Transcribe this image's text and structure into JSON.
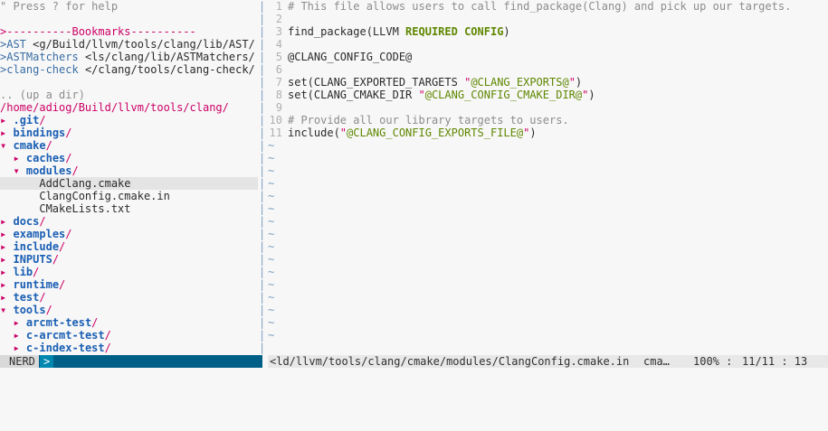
{
  "tree": {
    "help_line": "\" Press ? for help",
    "bookmarks_header": ">----------Bookmarks----------",
    "bookmarks": [
      {
        "name": "AST",
        "path": " <g/Build/llvm/tools/clang/lib/AST/"
      },
      {
        "name": "ASTMatchers",
        "path": " <ls/clang/lib/ASTMatchers/"
      },
      {
        "name": "clang-check",
        "path": " </clang/tools/clang-check/"
      }
    ],
    "up_dir": ".. (up a dir)",
    "root_path": "/home/adiog/Build/llvm/tools/clang/",
    "entries": [
      {
        "indent": 0,
        "kind": "dir",
        "open": false,
        "name": "git",
        "prefix": "."
      },
      {
        "indent": 0,
        "kind": "dir",
        "open": false,
        "name": "bindings"
      },
      {
        "indent": 0,
        "kind": "dir",
        "open": true,
        "name": "cmake"
      },
      {
        "indent": 1,
        "kind": "dir",
        "open": false,
        "name": "caches"
      },
      {
        "indent": 1,
        "kind": "dir",
        "open": true,
        "name": "modules"
      },
      {
        "indent": 2,
        "kind": "file",
        "name": "AddClang.cmake",
        "selected": true
      },
      {
        "indent": 2,
        "kind": "file",
        "name": "ClangConfig.cmake.in"
      },
      {
        "indent": 2,
        "kind": "file",
        "name": "CMakeLists.txt"
      },
      {
        "indent": 0,
        "kind": "dir",
        "open": false,
        "name": "docs"
      },
      {
        "indent": 0,
        "kind": "dir",
        "open": false,
        "name": "examples"
      },
      {
        "indent": 0,
        "kind": "dir",
        "open": false,
        "name": "include"
      },
      {
        "indent": 0,
        "kind": "dir",
        "open": false,
        "name": "INPUTS"
      },
      {
        "indent": 0,
        "kind": "dir",
        "open": false,
        "name": "lib"
      },
      {
        "indent": 0,
        "kind": "dir",
        "open": false,
        "name": "runtime"
      },
      {
        "indent": 0,
        "kind": "dir",
        "open": false,
        "name": "test"
      },
      {
        "indent": 0,
        "kind": "dir",
        "open": true,
        "name": "tools"
      },
      {
        "indent": 1,
        "kind": "dir",
        "open": false,
        "name": "arcmt-test"
      },
      {
        "indent": 1,
        "kind": "dir",
        "open": false,
        "name": "c-arcmt-test"
      },
      {
        "indent": 1,
        "kind": "dir",
        "open": false,
        "name": "c-index-test"
      }
    ],
    "glyph_closed": "▸",
    "glyph_open": "▾"
  },
  "editor": {
    "lines": [
      {
        "n": "1",
        "parts": [
          {
            "c": "comment",
            "t": "# This file allows users to call find_package(Clang) and pick up our targets."
          }
        ]
      },
      {
        "n": "2",
        "parts": []
      },
      {
        "n": "3",
        "parts": [
          {
            "c": "",
            "t": "find_package(LLVM "
          },
          {
            "c": "kw",
            "t": "REQUIRED CONFIG"
          },
          {
            "c": "",
            "t": ")"
          }
        ]
      },
      {
        "n": "4",
        "parts": []
      },
      {
        "n": "5",
        "parts": [
          {
            "c": "",
            "t": "@CLANG_CONFIG_CODE@"
          }
        ]
      },
      {
        "n": "6",
        "parts": []
      },
      {
        "n": "7",
        "parts": [
          {
            "c": "",
            "t": "set(CLANG_EXPORTED_TARGETS "
          },
          {
            "c": "strq",
            "t": "\""
          },
          {
            "c": "str",
            "t": "@CLANG_EXPORTS@"
          },
          {
            "c": "strq",
            "t": "\""
          },
          {
            "c": "",
            "t": ")"
          }
        ]
      },
      {
        "n": "8",
        "parts": [
          {
            "c": "",
            "t": "set(CLANG_CMAKE_DIR "
          },
          {
            "c": "strq",
            "t": "\""
          },
          {
            "c": "str",
            "t": "@CLANG_CONFIG_CMAKE_DIR@"
          },
          {
            "c": "strq",
            "t": "\""
          },
          {
            "c": "",
            "t": ")"
          }
        ]
      },
      {
        "n": "9",
        "parts": []
      },
      {
        "n": "10",
        "parts": [
          {
            "c": "comment",
            "t": "# Provide all our library targets to users."
          }
        ]
      },
      {
        "n": "11",
        "parts": [
          {
            "c": "",
            "t": "include("
          },
          {
            "c": "strq",
            "t": "\""
          },
          {
            "c": "str",
            "t": "@CLANG_CONFIG_EXPORTS_FILE@"
          },
          {
            "c": "strq",
            "t": "\""
          },
          {
            "c": "",
            "t": ")"
          }
        ]
      }
    ],
    "tilde": "~",
    "tilde_rows": 16
  },
  "split_char": "|",
  "status": {
    "mode": "NERD",
    "prompt": ">",
    "file": "<ld/llvm/tools/clang/cmake/modules/ClangConfig.cmake.in",
    "filetype": "cma…",
    "percent": "100% :",
    "position": "11/11 : 13"
  },
  "colors": {
    "directory": "#1a5fb4",
    "accent": "#cc0066",
    "status_bg": "#005f87",
    "keyword": "#5f8700"
  }
}
